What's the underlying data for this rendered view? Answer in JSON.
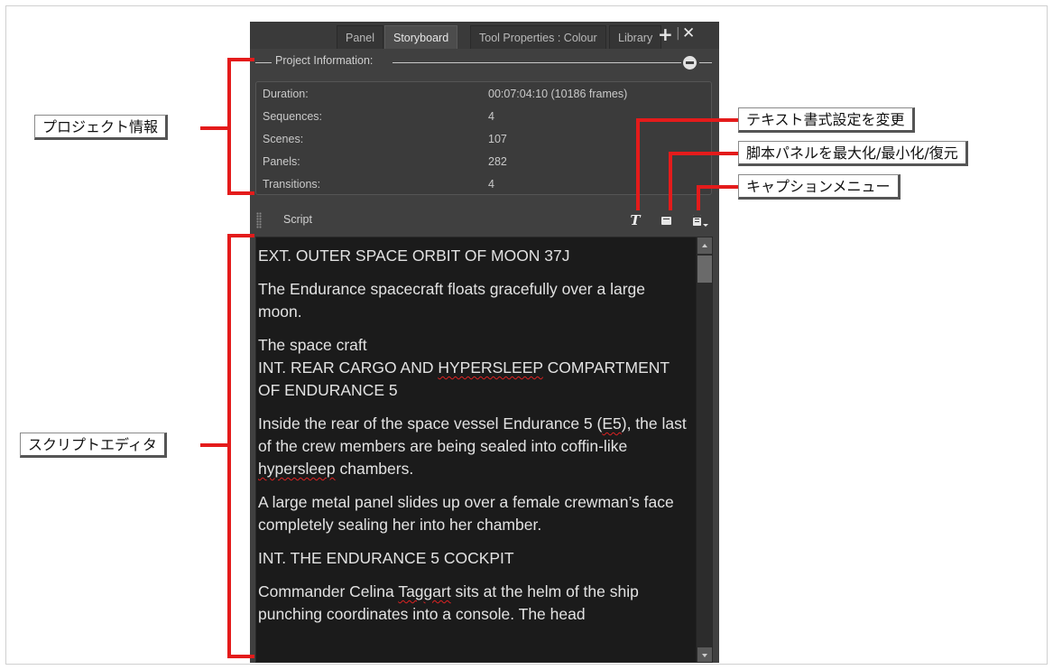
{
  "tabs": [
    {
      "label": "Panel"
    },
    {
      "label": "Storyboard"
    },
    {
      "label": "Tool Properties : Colour"
    },
    {
      "label": "Library"
    }
  ],
  "project_info": {
    "title": "Project Information:",
    "rows": [
      {
        "label": "Duration:",
        "value": "00:07:04:10  (10186 frames)"
      },
      {
        "label": "Sequences:",
        "value": "4"
      },
      {
        "label": "Scenes:",
        "value": "107"
      },
      {
        "label": "Panels:",
        "value": "282"
      },
      {
        "label": "Transitions:",
        "value": "4"
      }
    ]
  },
  "script": {
    "title": "Script",
    "text_format_glyph": "T",
    "paragraphs": [
      "EXT. OUTER SPACE ORBIT OF MOON 37J",
      "The Endurance spacecraft floats gracefully over a large moon.",
      "The space craft\nINT. REAR CARGO AND HYPERSLEEP COMPARTMENT OF ENDURANCE 5",
      "Inside the rear of the space vessel Endurance 5 (E5), the last of the crew members are being sealed into coffin-like hypersleep chambers.",
      "A large metal panel slides up over a female crewman’s face completely sealing her into her chamber.",
      "INT. THE ENDURANCE 5 COCKPIT",
      "Commander Celina Taggart sits at the helm of the ship punching coordinates into a console. The head"
    ]
  },
  "callouts": {
    "project_info": "プロジェクト情報",
    "text_format": "テキスト書式設定を変更",
    "maximize": "脚本パネルを最大化/最小化/復元",
    "caption_menu": "キャプションメニュー",
    "script_editor": "スクリプトエディタ"
  },
  "colors": {
    "callout_red": "#e41b1b",
    "panel_bg": "#404040",
    "editor_bg": "#1b1b1b",
    "spellcheck": "#dd2222"
  },
  "icons": [
    "add-tab-icon",
    "close-panel-icon",
    "collapse-icon",
    "grip-icon",
    "text-format-icon",
    "maximize-panel-icon",
    "caption-menu-icon"
  ]
}
